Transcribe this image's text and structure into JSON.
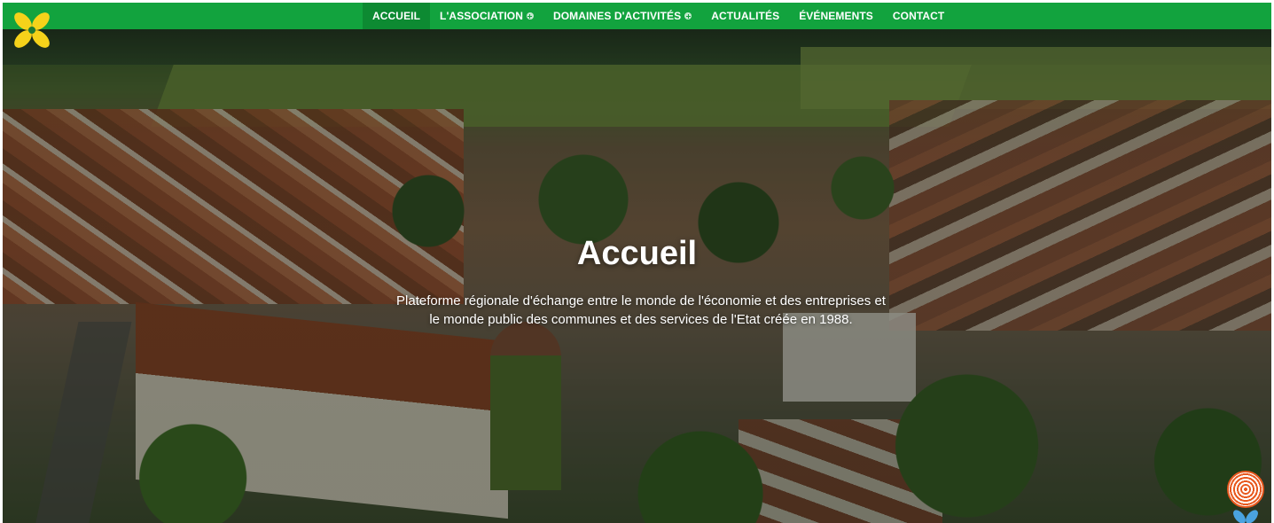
{
  "nav": {
    "items": [
      {
        "label": "ACCUEIL",
        "active": true,
        "has_submenu": false
      },
      {
        "label": "L'ASSOCIATION",
        "active": false,
        "has_submenu": true
      },
      {
        "label": "DOMAINES D'ACTIVITÉS",
        "active": false,
        "has_submenu": true
      },
      {
        "label": "ACTUALITÉS",
        "active": false,
        "has_submenu": false
      },
      {
        "label": "ÉVÉNEMENTS",
        "active": false,
        "has_submenu": false
      },
      {
        "label": "CONTACT",
        "active": false,
        "has_submenu": false
      }
    ]
  },
  "hero": {
    "title": "Accueil",
    "subtitle_line1": "Plateforme régionale d'échange entre le monde de l'économie et des entreprises et",
    "subtitle_line2": "le monde public des communes et des services de l'Etat créée en 1988."
  },
  "icons": {
    "logo": "yellow-flower-logo-icon",
    "submenu": "plus-circle-icon",
    "corner_widget": "orange-spiral-icon",
    "corner_flower": "blue-flower-icon"
  },
  "colors": {
    "nav_green": "#12a33e",
    "nav_active": "#0d8a32",
    "logo_yellow": "#f5d21a",
    "spiral_orange": "#e8581e",
    "flower_blue": "#4aa3e0"
  }
}
